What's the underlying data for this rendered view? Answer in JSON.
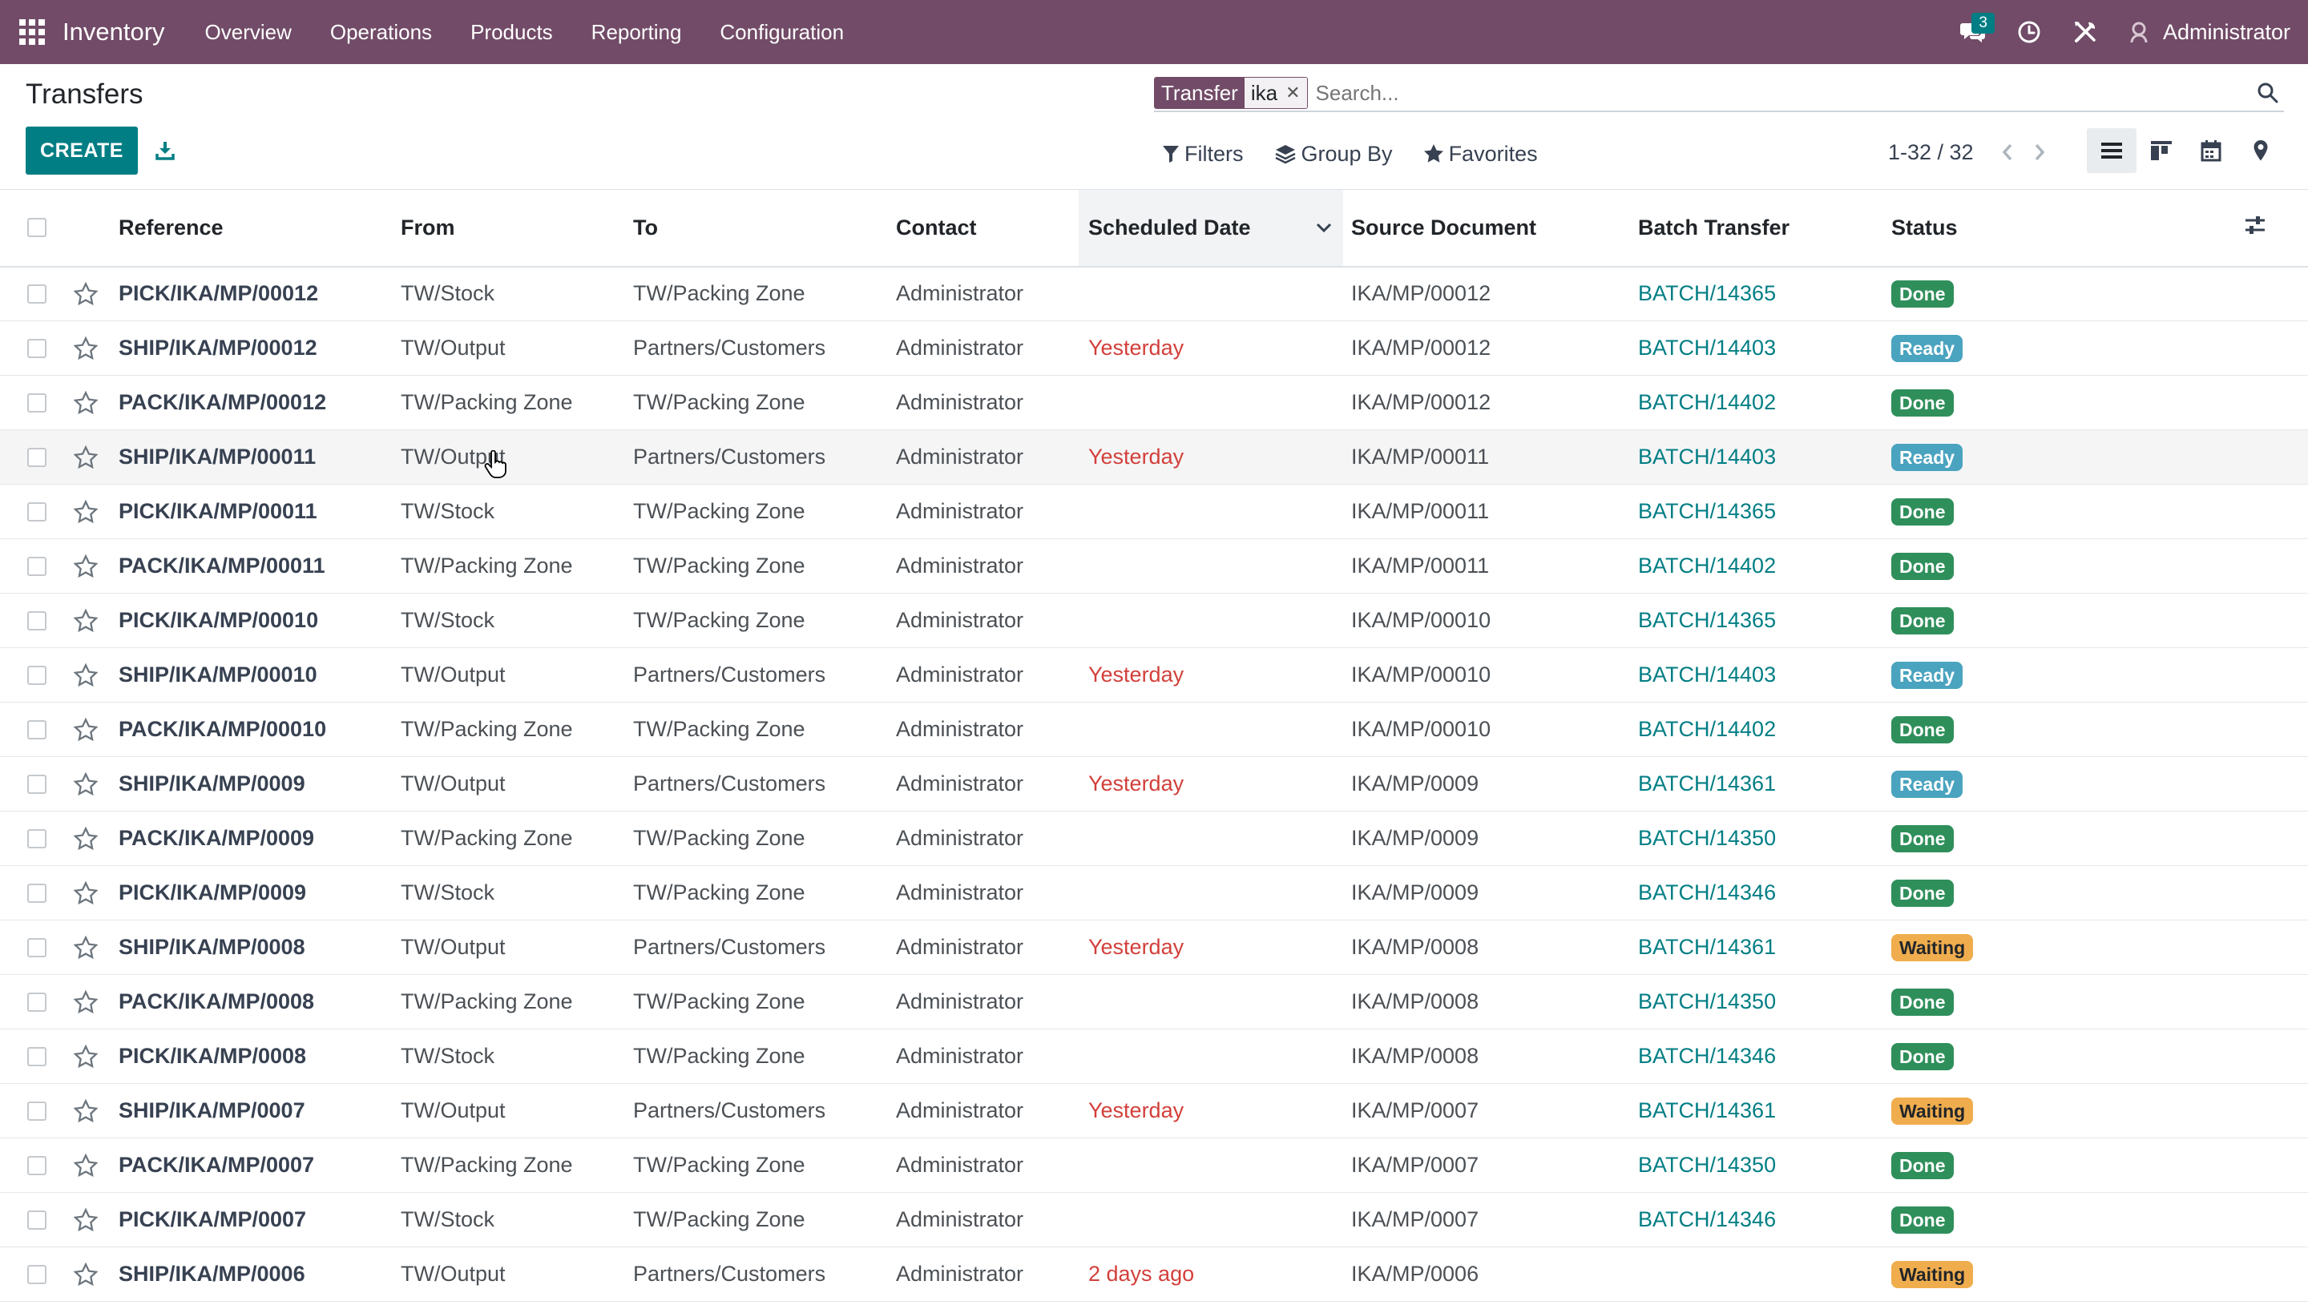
{
  "navbar": {
    "app_name": "Inventory",
    "menu": [
      "Overview",
      "Operations",
      "Products",
      "Reporting",
      "Configuration"
    ],
    "messages_count": "3",
    "user_name": "Administrator",
    "bar_color": "#714B67"
  },
  "control_panel": {
    "title": "Transfers",
    "facet_label": "Transfer",
    "facet_value": "ika",
    "search_placeholder": "Search...",
    "create_label": "CREATE",
    "filters_label": "Filters",
    "groupby_label": "Group By",
    "favorites_label": "Favorites",
    "pager": "1-32 / 32",
    "active_view": "list"
  },
  "table": {
    "columns": [
      "Reference",
      "From",
      "To",
      "Contact",
      "Scheduled Date",
      "Source Document",
      "Batch Transfer",
      "Status"
    ],
    "sorted_column": "Scheduled Date",
    "rows": [
      {
        "reference": "PICK/IKA/MP/00012",
        "from": "TW/Stock",
        "to": "TW/Packing Zone",
        "contact": "Administrator",
        "scheduled": "",
        "source": "IKA/MP/00012",
        "batch": "BATCH/14365",
        "status": "Done"
      },
      {
        "reference": "SHIP/IKA/MP/00012",
        "from": "TW/Output",
        "to": "Partners/Customers",
        "contact": "Administrator",
        "scheduled": "Yesterday",
        "source": "IKA/MP/00012",
        "batch": "BATCH/14403",
        "status": "Ready"
      },
      {
        "reference": "PACK/IKA/MP/00012",
        "from": "TW/Packing Zone",
        "to": "TW/Packing Zone",
        "contact": "Administrator",
        "scheduled": "",
        "source": "IKA/MP/00012",
        "batch": "BATCH/14402",
        "status": "Done"
      },
      {
        "reference": "SHIP/IKA/MP/00011",
        "from": "TW/Output",
        "to": "Partners/Customers",
        "contact": "Administrator",
        "scheduled": "Yesterday",
        "source": "IKA/MP/00011",
        "batch": "BATCH/14403",
        "status": "Ready"
      },
      {
        "reference": "PICK/IKA/MP/00011",
        "from": "TW/Stock",
        "to": "TW/Packing Zone",
        "contact": "Administrator",
        "scheduled": "",
        "source": "IKA/MP/00011",
        "batch": "BATCH/14365",
        "status": "Done"
      },
      {
        "reference": "PACK/IKA/MP/00011",
        "from": "TW/Packing Zone",
        "to": "TW/Packing Zone",
        "contact": "Administrator",
        "scheduled": "",
        "source": "IKA/MP/00011",
        "batch": "BATCH/14402",
        "status": "Done"
      },
      {
        "reference": "PICK/IKA/MP/00010",
        "from": "TW/Stock",
        "to": "TW/Packing Zone",
        "contact": "Administrator",
        "scheduled": "",
        "source": "IKA/MP/00010",
        "batch": "BATCH/14365",
        "status": "Done"
      },
      {
        "reference": "SHIP/IKA/MP/00010",
        "from": "TW/Output",
        "to": "Partners/Customers",
        "contact": "Administrator",
        "scheduled": "Yesterday",
        "source": "IKA/MP/00010",
        "batch": "BATCH/14403",
        "status": "Ready"
      },
      {
        "reference": "PACK/IKA/MP/00010",
        "from": "TW/Packing Zone",
        "to": "TW/Packing Zone",
        "contact": "Administrator",
        "scheduled": "",
        "source": "IKA/MP/00010",
        "batch": "BATCH/14402",
        "status": "Done"
      },
      {
        "reference": "SHIP/IKA/MP/0009",
        "from": "TW/Output",
        "to": "Partners/Customers",
        "contact": "Administrator",
        "scheduled": "Yesterday",
        "source": "IKA/MP/0009",
        "batch": "BATCH/14361",
        "status": "Ready"
      },
      {
        "reference": "PACK/IKA/MP/0009",
        "from": "TW/Packing Zone",
        "to": "TW/Packing Zone",
        "contact": "Administrator",
        "scheduled": "",
        "source": "IKA/MP/0009",
        "batch": "BATCH/14350",
        "status": "Done"
      },
      {
        "reference": "PICK/IKA/MP/0009",
        "from": "TW/Stock",
        "to": "TW/Packing Zone",
        "contact": "Administrator",
        "scheduled": "",
        "source": "IKA/MP/0009",
        "batch": "BATCH/14346",
        "status": "Done"
      },
      {
        "reference": "SHIP/IKA/MP/0008",
        "from": "TW/Output",
        "to": "Partners/Customers",
        "contact": "Administrator",
        "scheduled": "Yesterday",
        "source": "IKA/MP/0008",
        "batch": "BATCH/14361",
        "status": "Waiting"
      },
      {
        "reference": "PACK/IKA/MP/0008",
        "from": "TW/Packing Zone",
        "to": "TW/Packing Zone",
        "contact": "Administrator",
        "scheduled": "",
        "source": "IKA/MP/0008",
        "batch": "BATCH/14350",
        "status": "Done"
      },
      {
        "reference": "PICK/IKA/MP/0008",
        "from": "TW/Stock",
        "to": "TW/Packing Zone",
        "contact": "Administrator",
        "scheduled": "",
        "source": "IKA/MP/0008",
        "batch": "BATCH/14346",
        "status": "Done"
      },
      {
        "reference": "SHIP/IKA/MP/0007",
        "from": "TW/Output",
        "to": "Partners/Customers",
        "contact": "Administrator",
        "scheduled": "Yesterday",
        "source": "IKA/MP/0007",
        "batch": "BATCH/14361",
        "status": "Waiting"
      },
      {
        "reference": "PACK/IKA/MP/0007",
        "from": "TW/Packing Zone",
        "to": "TW/Packing Zone",
        "contact": "Administrator",
        "scheduled": "",
        "source": "IKA/MP/0007",
        "batch": "BATCH/14350",
        "status": "Done"
      },
      {
        "reference": "PICK/IKA/MP/0007",
        "from": "TW/Stock",
        "to": "TW/Packing Zone",
        "contact": "Administrator",
        "scheduled": "",
        "source": "IKA/MP/0007",
        "batch": "BATCH/14346",
        "status": "Done"
      },
      {
        "reference": "SHIP/IKA/MP/0006",
        "from": "TW/Output",
        "to": "Partners/Customers",
        "contact": "Administrator",
        "scheduled": "2 days ago",
        "source": "IKA/MP/0006",
        "batch": "",
        "status": "Waiting"
      }
    ]
  },
  "colors": {
    "accent": "#017e84",
    "late": "#d23f3a",
    "done": "#2f8f5b",
    "ready": "#4aa3bf",
    "waiting": "#f0ad4e"
  }
}
